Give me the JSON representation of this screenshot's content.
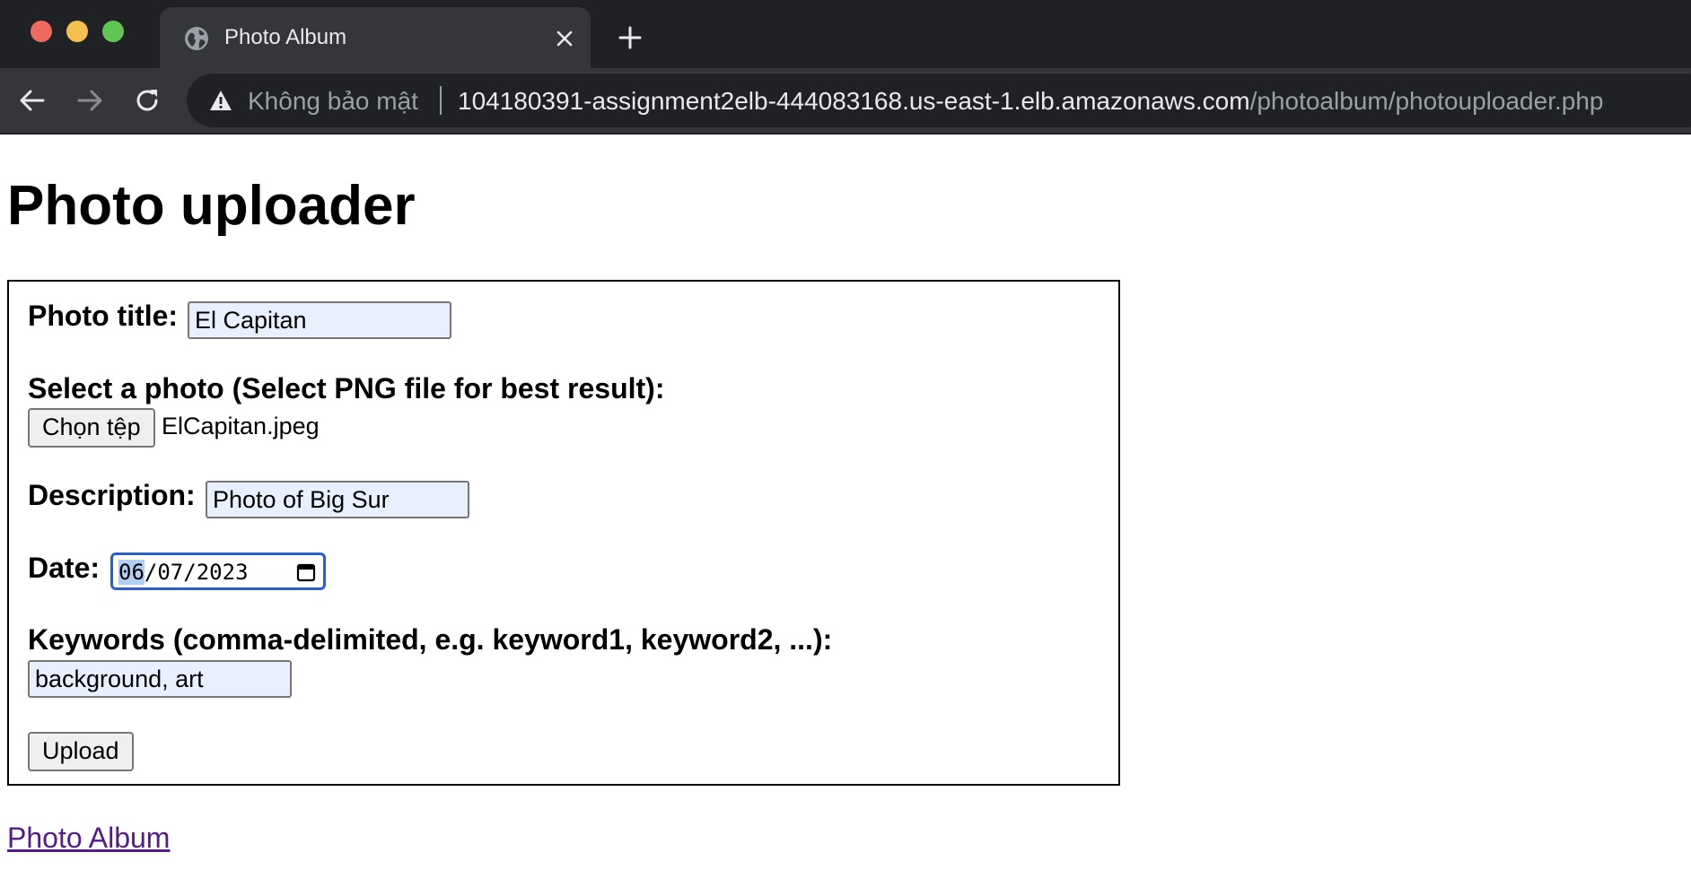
{
  "browser": {
    "tab_title": "Photo Album",
    "security_label": "Không bảo mật",
    "url_host": "104180391-assignment2elb-444083168.us-east-1.elb.amazonaws.com",
    "url_path": "/photoalbum/photouploader.php"
  },
  "page": {
    "title": "Photo uploader",
    "footer_link": "Photo Album"
  },
  "form": {
    "photo_title_label": "Photo title:",
    "photo_title_value": "El Capitan",
    "select_photo_label": "Select a photo (Select PNG file for best result):",
    "choose_file_button": "Chọn tệp",
    "selected_file_name": "ElCapitan.jpeg",
    "description_label": "Description:",
    "description_value": "Photo of Big Sur",
    "date_label": "Date:",
    "date_month": "06",
    "date_day": "07",
    "date_year": "2023",
    "keywords_label": "Keywords (comma-delimited, e.g. keyword1, keyword2, ...):",
    "keywords_value": "background, art",
    "upload_button": "Upload"
  },
  "icons": {
    "tab_favicon": "globe-icon",
    "tab_close": "close-icon",
    "new_tab": "plus-icon",
    "back": "arrow-left-icon",
    "forward": "arrow-right-icon",
    "reload": "reload-icon",
    "security": "warning-icon",
    "date_picker": "calendar-icon"
  }
}
